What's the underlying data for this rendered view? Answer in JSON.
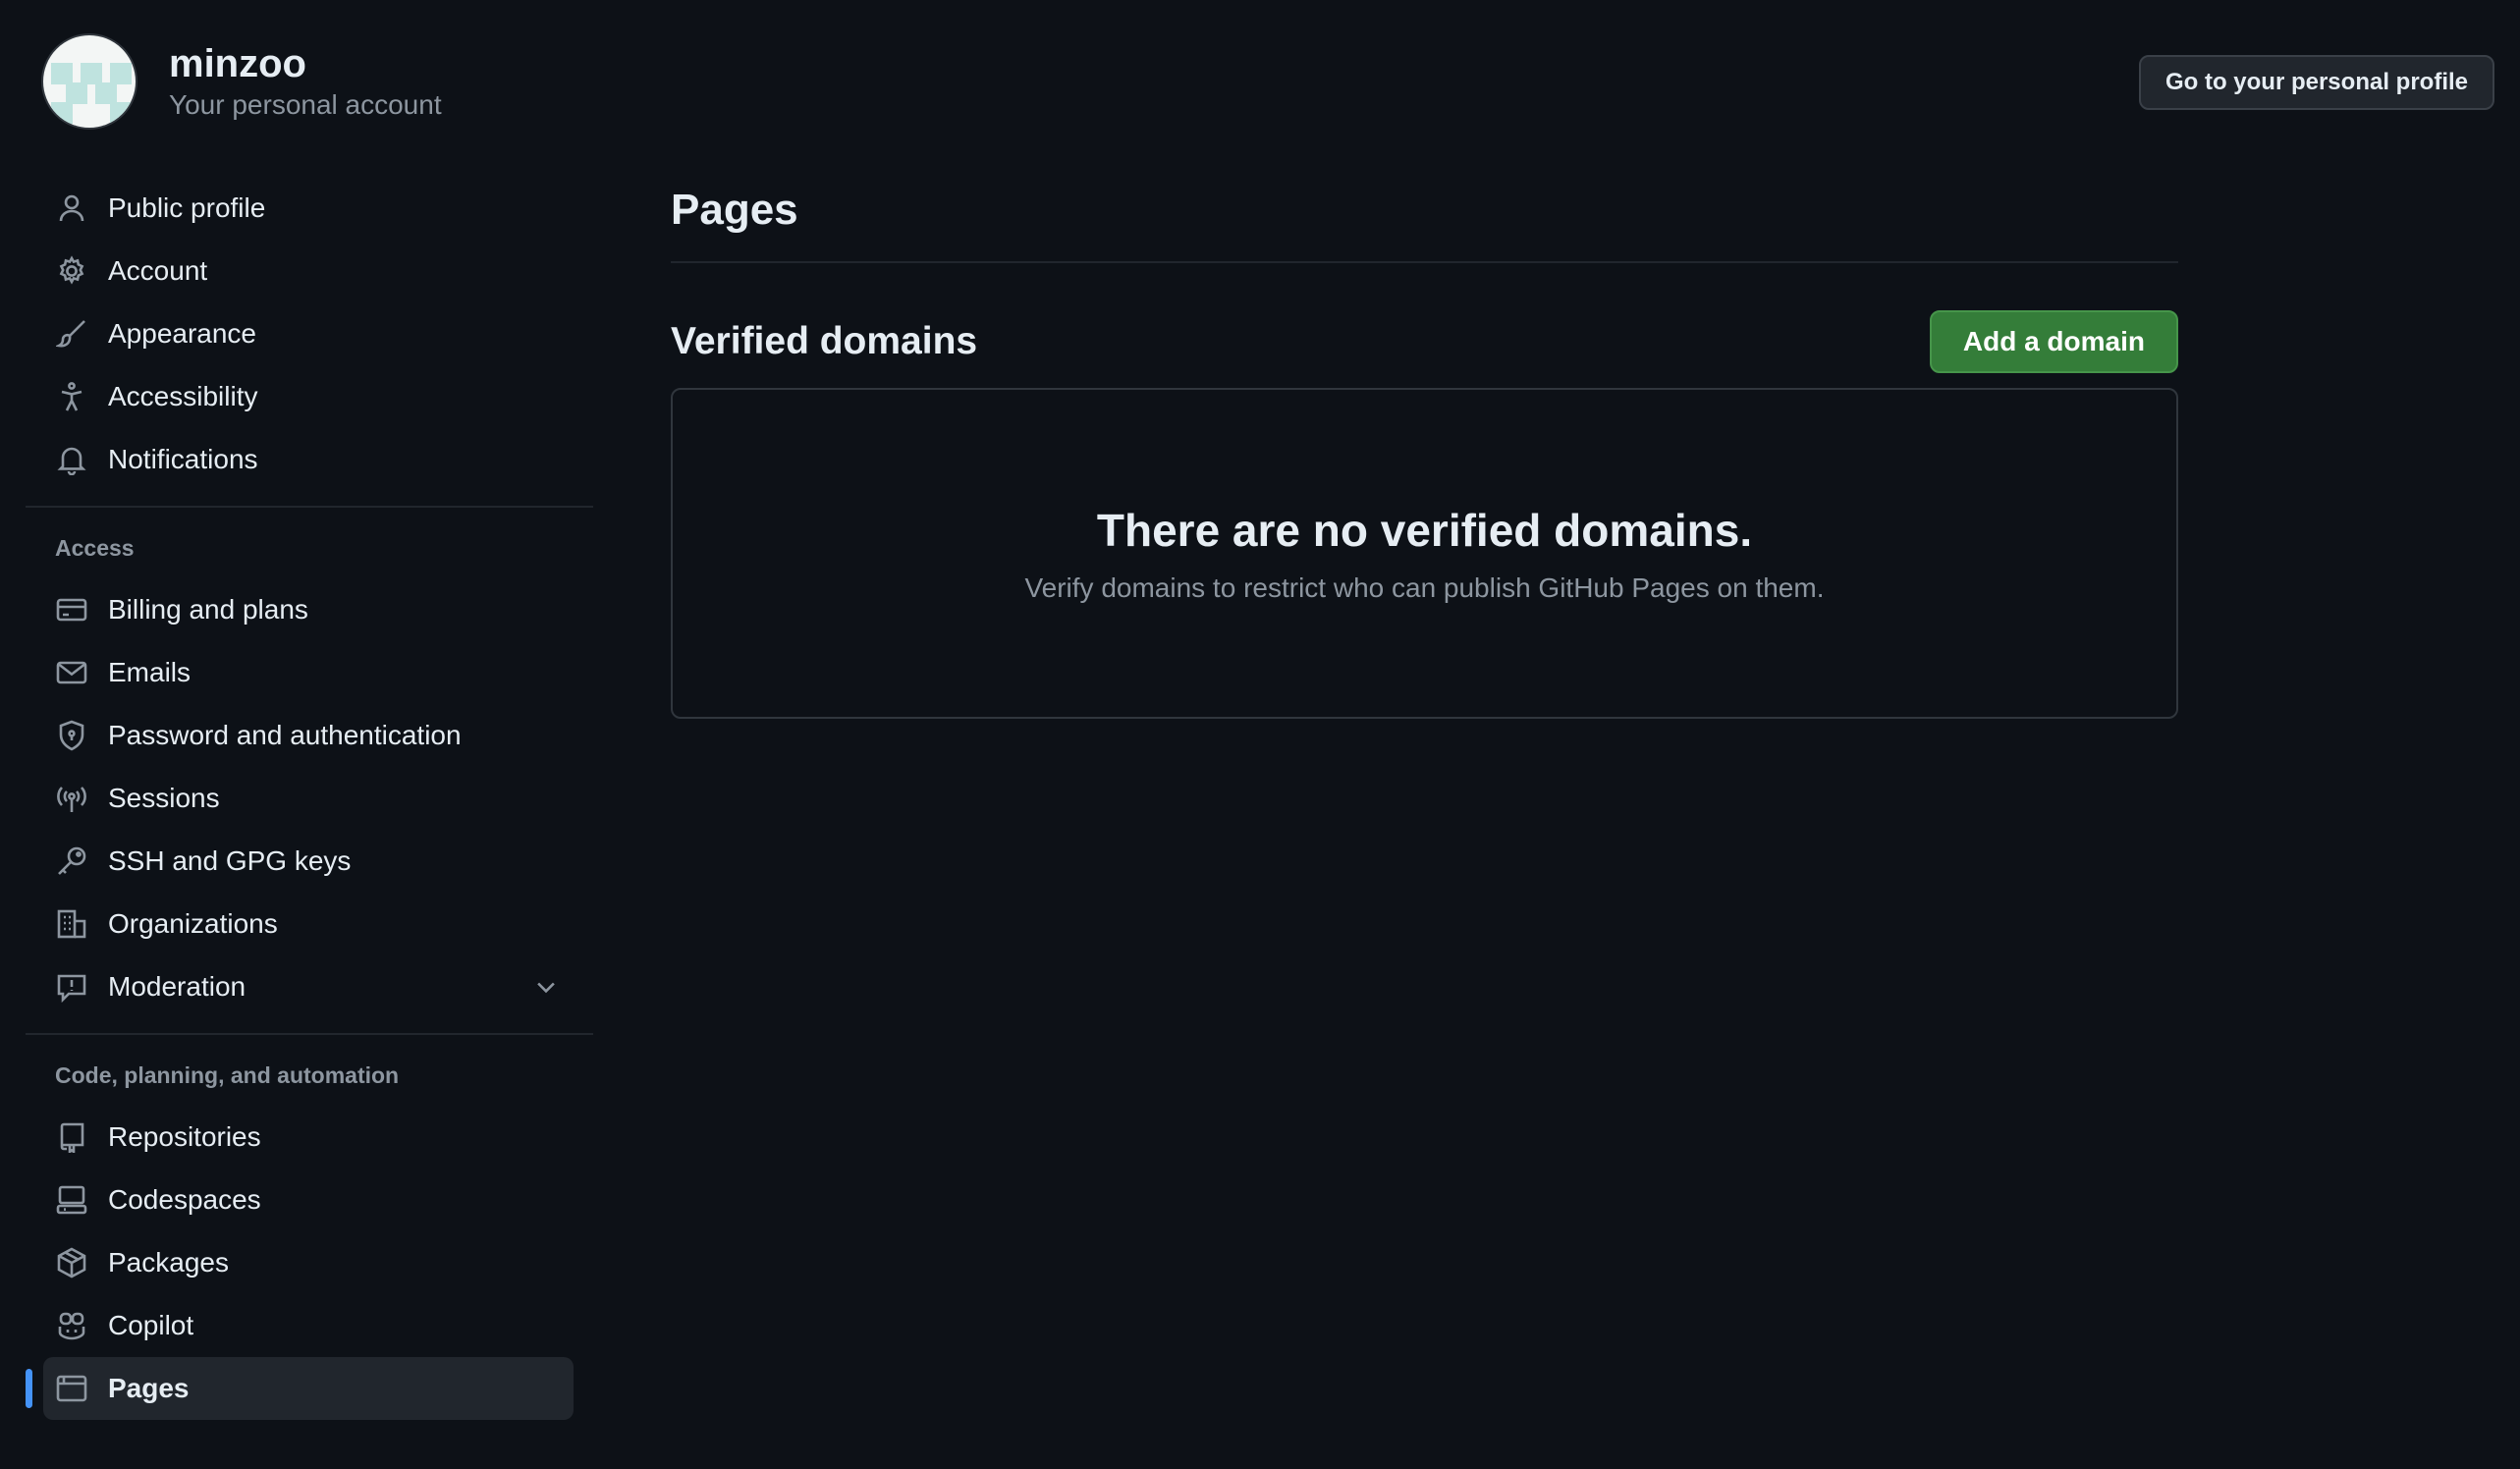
{
  "user": {
    "name": "minzoo",
    "subtitle": "Your personal account"
  },
  "header": {
    "profile_button": "Go to your personal profile"
  },
  "sidebar": {
    "items": [
      {
        "label": "Public profile",
        "icon": "person-icon"
      },
      {
        "label": "Account",
        "icon": "gear-icon"
      },
      {
        "label": "Appearance",
        "icon": "paintbrush-icon"
      },
      {
        "label": "Accessibility",
        "icon": "accessibility-icon"
      },
      {
        "label": "Notifications",
        "icon": "bell-icon"
      }
    ],
    "access_heading": "Access",
    "access_items": [
      {
        "label": "Billing and plans",
        "icon": "credit-card-icon"
      },
      {
        "label": "Emails",
        "icon": "mail-icon"
      },
      {
        "label": "Password and authentication",
        "icon": "shield-lock-icon"
      },
      {
        "label": "Sessions",
        "icon": "broadcast-icon"
      },
      {
        "label": "SSH and GPG keys",
        "icon": "key-icon"
      },
      {
        "label": "Organizations",
        "icon": "organization-icon"
      },
      {
        "label": "Moderation",
        "icon": "report-icon"
      }
    ],
    "code_heading": "Code, planning, and automation",
    "code_items": [
      {
        "label": "Repositories",
        "icon": "repo-icon"
      },
      {
        "label": "Codespaces",
        "icon": "codespaces-icon"
      },
      {
        "label": "Packages",
        "icon": "package-icon"
      },
      {
        "label": "Copilot",
        "icon": "copilot-icon"
      },
      {
        "label": "Pages",
        "icon": "browser-icon",
        "active": true
      }
    ]
  },
  "main": {
    "title": "Pages",
    "section_title": "Verified domains",
    "add_button": "Add a domain",
    "blank_title": "There are no verified domains.",
    "blank_description": "Verify domains to restrict who can publish GitHub Pages on them."
  },
  "colors": {
    "background": "#0d1117",
    "accent": "#4493f8",
    "primary_button": "#347d39",
    "muted_text": "#8d96a0"
  }
}
